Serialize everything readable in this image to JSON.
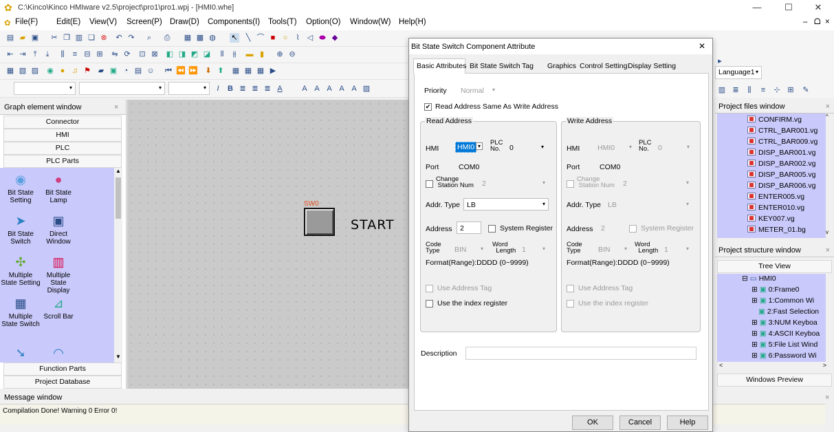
{
  "app": {
    "title": "C:\\Kinco\\Kinco HMIware v2.5\\project\\pro1\\pro1.wpj - [HMI0.whe]",
    "min": "—",
    "max": "☐",
    "close": "✕"
  },
  "menu": [
    "File(F)",
    "Edit(E)",
    "View(V)",
    "Screen(P)",
    "Draw(D)",
    "Components(I)",
    "Tools(T)",
    "Option(O)",
    "Window(W)",
    "Help(H)"
  ],
  "menu_right": {
    "min": "–",
    "restore": "ᗝ",
    "close": "×"
  },
  "toolbar": {
    "language": "Language1"
  },
  "left_panel": {
    "title": "Graph element window",
    "close": "×",
    "categories": [
      "Connector",
      "HMI",
      "PLC",
      "PLC Parts"
    ],
    "items": [
      {
        "l1": "Bit State",
        "l2": "Setting",
        "icon": "bulb-icon"
      },
      {
        "l1": "Bit State",
        "l2": "Lamp",
        "icon": "lamp-icon"
      },
      {
        "l1": "Bit State",
        "l2": "Switch",
        "icon": "switch-icon"
      },
      {
        "l1": "Direct",
        "l2": "Window",
        "icon": "window-icon"
      },
      {
        "l1": "Multiple",
        "l2": "State Setting",
        "icon": "multi-setting-icon"
      },
      {
        "l1": "Multiple",
        "l2": "State Display",
        "icon": "multi-display-icon"
      },
      {
        "l1": "Multiple",
        "l2": "State Switch",
        "icon": "multi-switch-icon"
      },
      {
        "l1": "Scroll Bar",
        "l2": "",
        "icon": "scrollbar-icon"
      }
    ],
    "bottom": [
      "Function Parts",
      "Project Database"
    ]
  },
  "canvas": {
    "sw_label": "SW0",
    "button_text": "START"
  },
  "message": {
    "title": "Message window",
    "text": "Compilation Done! Warning 0 Error 0!"
  },
  "right_panel": {
    "files_title": "Project files window",
    "files": [
      "CONFIRM.vg",
      "CTRL_BAR001.vg",
      "CTRL_BAR009.vg",
      "DISP_BAR001.vg",
      "DISP_BAR002.vg",
      "DISP_BAR005.vg",
      "DISP_BAR006.vg",
      "ENTER005.vg",
      "ENTER010.vg",
      "KEY007.vg",
      "METER_01.bg"
    ],
    "structure_title": "Project structure window",
    "tree_view": "Tree View",
    "tree": [
      "HMI0",
      "0:Frame0",
      "1:Common Wi",
      "2:Fast Selection",
      "3:NUM Keyboa",
      "4:ASCII Keyboa",
      "5:File List Wind",
      "6:Password Wi"
    ],
    "preview": "Windows Preview"
  },
  "dialog": {
    "title": "Bit State Switch Component Attribute",
    "tabs": [
      "Basic Attributes",
      "Bit State Switch",
      "Tag",
      "Graphics",
      "Control Setting",
      "Display Setting"
    ],
    "priority_label": "Priority",
    "priority_value": "Normal",
    "same_addr": "Read Address Same As Write Address",
    "read": {
      "title": "Read Address",
      "hmi": "HMI",
      "hmi_val": "HMI0",
      "plc": "PLC",
      "no": "No.",
      "plc_val": "0",
      "port": "Port",
      "port_val": "COM0",
      "change": "Change",
      "station": "Station Num",
      "station_val": "2",
      "addr_type": "Addr. Type",
      "addr_type_val": "LB",
      "address": "Address",
      "address_val": "2",
      "sysreg": "System Register",
      "code": "Code",
      "type": "Type",
      "code_val": "BIN",
      "word": "Word",
      "length": "Length",
      "word_val": "1",
      "format": "Format(Range):DDDD (0~9999)",
      "use_tag": "Use Address Tag",
      "use_index": "Use the index register"
    },
    "write": {
      "title": "Write Address",
      "hmi": "HMI",
      "hmi_val": "HMI0",
      "plc": "PLC",
      "no": "No.",
      "plc_val": "0",
      "port": "Port",
      "port_val": "COM0",
      "change": "Change",
      "station": "Station Num",
      "station_val": "2",
      "addr_type": "Addr. Type",
      "addr_type_val": "LB",
      "address": "Address",
      "address_val": "2",
      "sysreg": "System Register",
      "code": "Code",
      "type": "Type",
      "code_val": "BIN",
      "word": "Word",
      "length": "Length",
      "word_val": "1",
      "format": "Format(Range):DDDD (0~9999)",
      "use_tag": "Use Address Tag",
      "use_index": "Use the index register"
    },
    "description": "Description",
    "ok": "OK",
    "cancel": "Cancel",
    "help": "Help",
    "close": "✕"
  }
}
